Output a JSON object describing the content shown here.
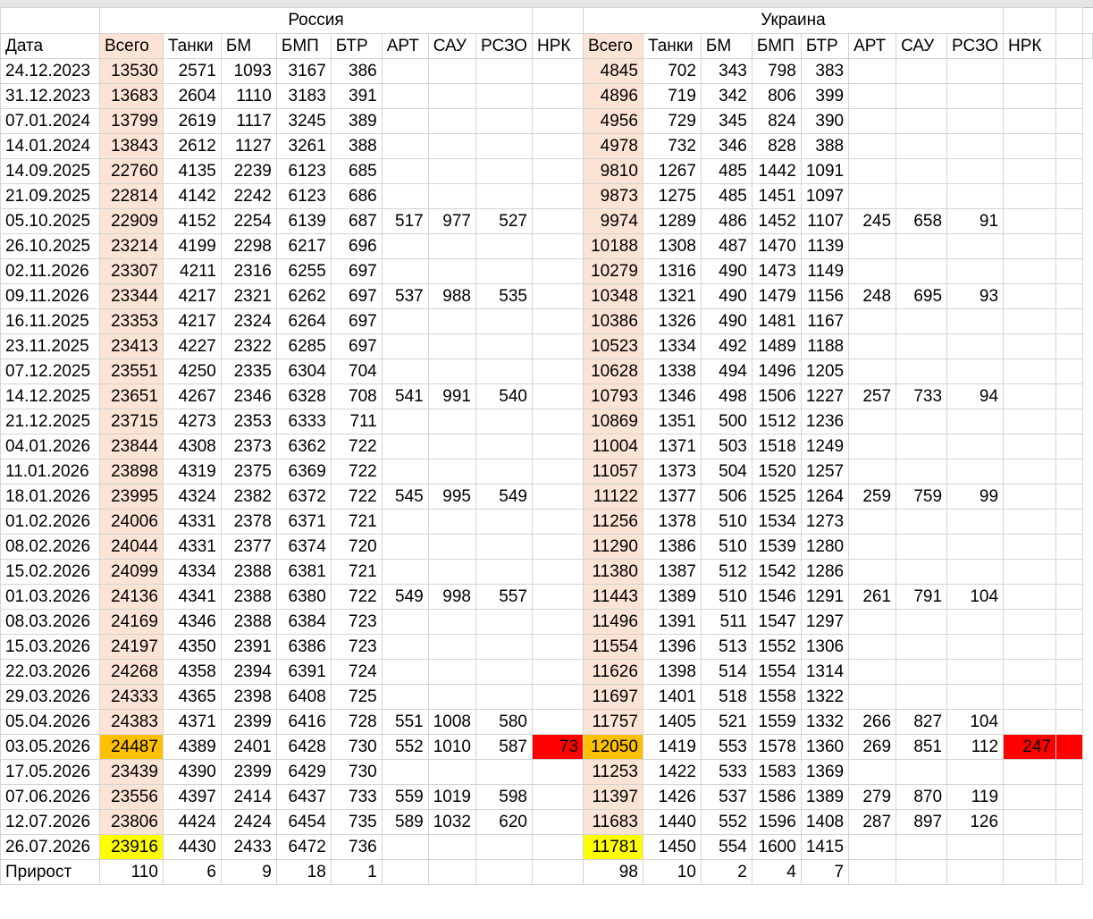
{
  "sheet": {
    "group_headers": {
      "russia": "Россия",
      "ukraine": "Украина"
    },
    "date_header": "Дата",
    "columns": [
      "Всего",
      "Танки",
      "БМ",
      "БМП",
      "БТР",
      "АРТ",
      "САУ",
      "РСЗО",
      "НРК"
    ],
    "highlight_colors": {
      "vsego_column": "#fbe4d5",
      "orange": "#ffc000",
      "red": "#ff0000",
      "yellow": "#ffff00"
    },
    "rows": [
      {
        "date": "24.12.2023",
        "ru": [
          "13530",
          "2571",
          "1093",
          "3167",
          "386",
          "",
          "",
          "",
          ""
        ],
        "ua": [
          "4845",
          "702",
          "343",
          "798",
          "383",
          "",
          "",
          "",
          ""
        ]
      },
      {
        "date": "31.12.2023",
        "ru": [
          "13683",
          "2604",
          "1110",
          "3183",
          "391",
          "",
          "",
          "",
          ""
        ],
        "ua": [
          "4896",
          "719",
          "342",
          "806",
          "399",
          "",
          "",
          "",
          ""
        ]
      },
      {
        "date": "07.01.2024",
        "ru": [
          "13799",
          "2619",
          "1117",
          "3245",
          "389",
          "",
          "",
          "",
          ""
        ],
        "ua": [
          "4956",
          "729",
          "345",
          "824",
          "390",
          "",
          "",
          "",
          ""
        ]
      },
      {
        "date": "14.01.2024",
        "ru": [
          "13843",
          "2612",
          "1127",
          "3261",
          "388",
          "",
          "",
          "",
          ""
        ],
        "ua": [
          "4978",
          "732",
          "346",
          "828",
          "388",
          "",
          "",
          "",
          ""
        ]
      },
      {
        "date": "14.09.2025",
        "ru": [
          "22760",
          "4135",
          "2239",
          "6123",
          "685",
          "",
          "",
          "",
          ""
        ],
        "ua": [
          "9810",
          "1267",
          "485",
          "1442",
          "1091",
          "",
          "",
          "",
          ""
        ]
      },
      {
        "date": "21.09.2025",
        "ru": [
          "22814",
          "4142",
          "2242",
          "6123",
          "686",
          "",
          "",
          "",
          ""
        ],
        "ua": [
          "9873",
          "1275",
          "485",
          "1451",
          "1097",
          "",
          "",
          "",
          ""
        ]
      },
      {
        "date": "05.10.2025",
        "ru": [
          "22909",
          "4152",
          "2254",
          "6139",
          "687",
          "517",
          "977",
          "527",
          ""
        ],
        "ua": [
          "9974",
          "1289",
          "486",
          "1452",
          "1107",
          "245",
          "658",
          "91",
          ""
        ]
      },
      {
        "date": "26.10.2025",
        "ru": [
          "23214",
          "4199",
          "2298",
          "6217",
          "696",
          "",
          "",
          "",
          ""
        ],
        "ua": [
          "10188",
          "1308",
          "487",
          "1470",
          "1139",
          "",
          "",
          "",
          ""
        ]
      },
      {
        "date": "02.11.2026",
        "ru": [
          "23307",
          "4211",
          "2316",
          "6255",
          "697",
          "",
          "",
          "",
          ""
        ],
        "ua": [
          "10279",
          "1316",
          "490",
          "1473",
          "1149",
          "",
          "",
          "",
          ""
        ]
      },
      {
        "date": "09.11.2026",
        "ru": [
          "23344",
          "4217",
          "2321",
          "6262",
          "697",
          "537",
          "988",
          "535",
          ""
        ],
        "ua": [
          "10348",
          "1321",
          "490",
          "1479",
          "1156",
          "248",
          "695",
          "93",
          ""
        ]
      },
      {
        "date": "16.11.2025",
        "ru": [
          "23353",
          "4217",
          "2324",
          "6264",
          "697",
          "",
          "",
          "",
          ""
        ],
        "ua": [
          "10386",
          "1326",
          "490",
          "1481",
          "1167",
          "",
          "",
          "",
          ""
        ]
      },
      {
        "date": "23.11.2025",
        "ru": [
          "23413",
          "4227",
          "2322",
          "6285",
          "697",
          "",
          "",
          "",
          ""
        ],
        "ua": [
          "10523",
          "1334",
          "492",
          "1489",
          "1188",
          "",
          "",
          "",
          ""
        ]
      },
      {
        "date": "07.12.2025",
        "ru": [
          "23551",
          "4250",
          "2335",
          "6304",
          "704",
          "",
          "",
          "",
          ""
        ],
        "ua": [
          "10628",
          "1338",
          "494",
          "1496",
          "1205",
          "",
          "",
          "",
          ""
        ]
      },
      {
        "date": "14.12.2025",
        "ru": [
          "23651",
          "4267",
          "2346",
          "6328",
          "708",
          "541",
          "991",
          "540",
          ""
        ],
        "ua": [
          "10793",
          "1346",
          "498",
          "1506",
          "1227",
          "257",
          "733",
          "94",
          ""
        ]
      },
      {
        "date": "21.12.2025",
        "ru": [
          "23715",
          "4273",
          "2353",
          "6333",
          "711",
          "",
          "",
          "",
          ""
        ],
        "ua": [
          "10869",
          "1351",
          "500",
          "1512",
          "1236",
          "",
          "",
          "",
          ""
        ]
      },
      {
        "date": "04.01.2026",
        "ru": [
          "23844",
          "4308",
          "2373",
          "6362",
          "722",
          "",
          "",
          "",
          ""
        ],
        "ua": [
          "11004",
          "1371",
          "503",
          "1518",
          "1249",
          "",
          "",
          "",
          ""
        ]
      },
      {
        "date": "11.01.2026",
        "ru": [
          "23898",
          "4319",
          "2375",
          "6369",
          "722",
          "",
          "",
          "",
          ""
        ],
        "ua": [
          "11057",
          "1373",
          "504",
          "1520",
          "1257",
          "",
          "",
          "",
          ""
        ]
      },
      {
        "date": "18.01.2026",
        "ru": [
          "23995",
          "4324",
          "2382",
          "6372",
          "722",
          "545",
          "995",
          "549",
          ""
        ],
        "ua": [
          "11122",
          "1377",
          "506",
          "1525",
          "1264",
          "259",
          "759",
          "99",
          ""
        ]
      },
      {
        "date": "01.02.2026",
        "ru": [
          "24006",
          "4331",
          "2378",
          "6371",
          "721",
          "",
          "",
          "",
          ""
        ],
        "ua": [
          "11256",
          "1378",
          "510",
          "1534",
          "1273",
          "",
          "",
          "",
          ""
        ]
      },
      {
        "date": "08.02.2026",
        "ru": [
          "24044",
          "4331",
          "2377",
          "6374",
          "720",
          "",
          "",
          "",
          ""
        ],
        "ua": [
          "11290",
          "1386",
          "510",
          "1539",
          "1280",
          "",
          "",
          "",
          ""
        ]
      },
      {
        "date": "15.02.2026",
        "ru": [
          "24099",
          "4334",
          "2388",
          "6381",
          "721",
          "",
          "",
          "",
          ""
        ],
        "ua": [
          "11380",
          "1387",
          "512",
          "1542",
          "1286",
          "",
          "",
          "",
          ""
        ]
      },
      {
        "date": "01.03.2026",
        "ru": [
          "24136",
          "4341",
          "2388",
          "6380",
          "722",
          "549",
          "998",
          "557",
          ""
        ],
        "ua": [
          "11443",
          "1389",
          "510",
          "1546",
          "1291",
          "261",
          "791",
          "104",
          ""
        ]
      },
      {
        "date": "08.03.2026",
        "ru": [
          "24169",
          "4346",
          "2388",
          "6384",
          "723",
          "",
          "",
          "",
          ""
        ],
        "ua": [
          "11496",
          "1391",
          "511",
          "1547",
          "1297",
          "",
          "",
          "",
          ""
        ]
      },
      {
        "date": "15.03.2026",
        "ru": [
          "24197",
          "4350",
          "2391",
          "6386",
          "723",
          "",
          "",
          "",
          ""
        ],
        "ua": [
          "11554",
          "1396",
          "513",
          "1552",
          "1306",
          "",
          "",
          "",
          ""
        ]
      },
      {
        "date": "22.03.2026",
        "ru": [
          "24268",
          "4358",
          "2394",
          "6391",
          "724",
          "",
          "",
          "",
          ""
        ],
        "ua": [
          "11626",
          "1398",
          "514",
          "1554",
          "1314",
          "",
          "",
          "",
          ""
        ]
      },
      {
        "date": "29.03.2026",
        "ru": [
          "24333",
          "4365",
          "2398",
          "6408",
          "725",
          "",
          "",
          "",
          ""
        ],
        "ua": [
          "11697",
          "1401",
          "518",
          "1558",
          "1322",
          "",
          "",
          "",
          ""
        ]
      },
      {
        "date": "05.04.2026",
        "ru": [
          "24383",
          "4371",
          "2399",
          "6416",
          "728",
          "551",
          "1008",
          "580",
          ""
        ],
        "ua": [
          "11757",
          "1405",
          "521",
          "1559",
          "1332",
          "266",
          "827",
          "104",
          ""
        ]
      },
      {
        "date": "03.05.2026",
        "ru": [
          "24487",
          "4389",
          "2401",
          "6428",
          "730",
          "552",
          "1010",
          "587",
          "73"
        ],
        "ua": [
          "12050",
          "1419",
          "553",
          "1578",
          "1360",
          "269",
          "851",
          "112",
          "247"
        ],
        "ru_total_hl": "orange",
        "ua_total_hl": "orange",
        "nrk_hl": "red"
      },
      {
        "date": "17.05.2026",
        "ru": [
          "23439",
          "4390",
          "2399",
          "6429",
          "730",
          "",
          "",
          "",
          ""
        ],
        "ua": [
          "11253",
          "1422",
          "533",
          "1583",
          "1369",
          "",
          "",
          "",
          ""
        ]
      },
      {
        "date": "07.06.2026",
        "ru": [
          "23556",
          "4397",
          "2414",
          "6437",
          "733",
          "559",
          "1019",
          "598",
          ""
        ],
        "ua": [
          "11397",
          "1426",
          "537",
          "1586",
          "1389",
          "279",
          "870",
          "119",
          ""
        ]
      },
      {
        "date": "12.07.2026",
        "ru": [
          "23806",
          "4424",
          "2424",
          "6454",
          "735",
          "589",
          "1032",
          "620",
          ""
        ],
        "ua": [
          "11683",
          "1440",
          "552",
          "1596",
          "1408",
          "287",
          "897",
          "126",
          ""
        ]
      },
      {
        "date": "26.07.2026",
        "ru": [
          "23916",
          "4430",
          "2433",
          "6472",
          "736",
          "",
          "",
          "",
          ""
        ],
        "ua": [
          "11781",
          "1450",
          "554",
          "1600",
          "1415",
          "",
          "",
          "",
          ""
        ],
        "ru_total_hl": "yellow",
        "ua_total_hl": "yellow"
      }
    ],
    "growth": {
      "label": "Прирост",
      "ru": [
        "110",
        "6",
        "9",
        "18",
        "1",
        "",
        "",
        "",
        ""
      ],
      "ua": [
        "98",
        "10",
        "2",
        "4",
        "7",
        "",
        "",
        "",
        ""
      ]
    }
  }
}
